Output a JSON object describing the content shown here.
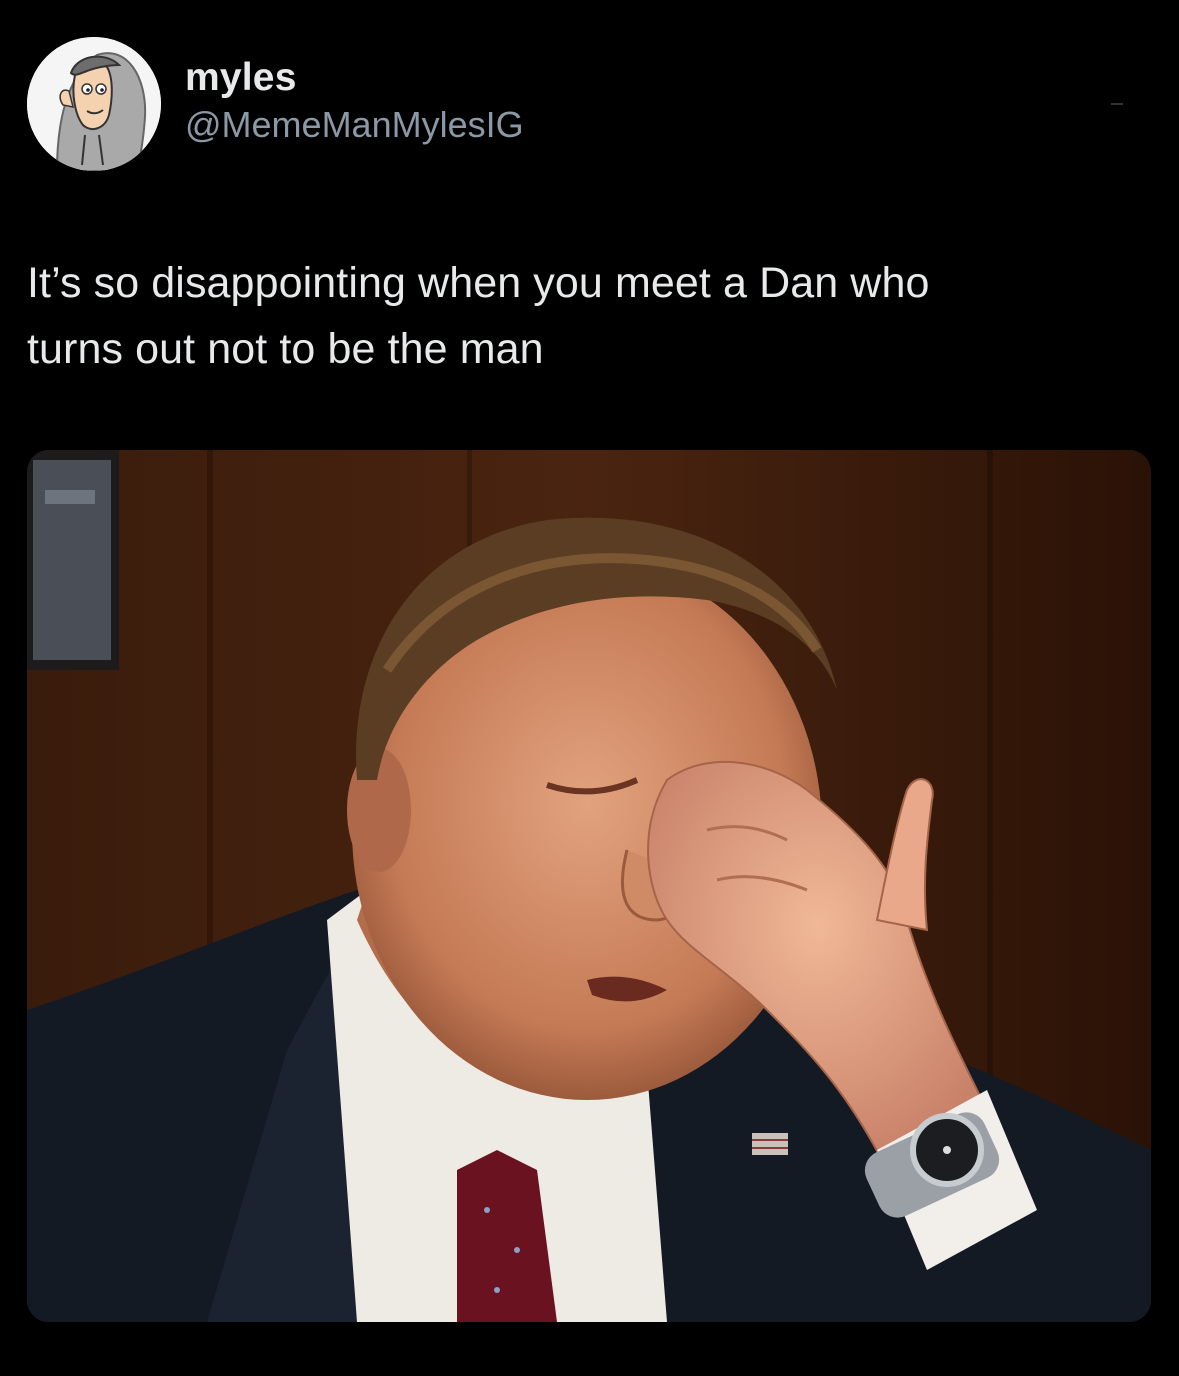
{
  "tweet": {
    "author": {
      "display_name": "myles",
      "handle": "@MemeManMylesIG",
      "avatar_icon": "cartoon-hooded-avatar-icon"
    },
    "text_lines": [
      "It’s so disappointing when you meet a Dan who",
      "turns out not to be the man"
    ],
    "media": {
      "icon": "facepalm-photo"
    }
  },
  "colors": {
    "background": "#000000",
    "primary_text": "#e7e9ea",
    "secondary_text": "#8b98a5"
  }
}
